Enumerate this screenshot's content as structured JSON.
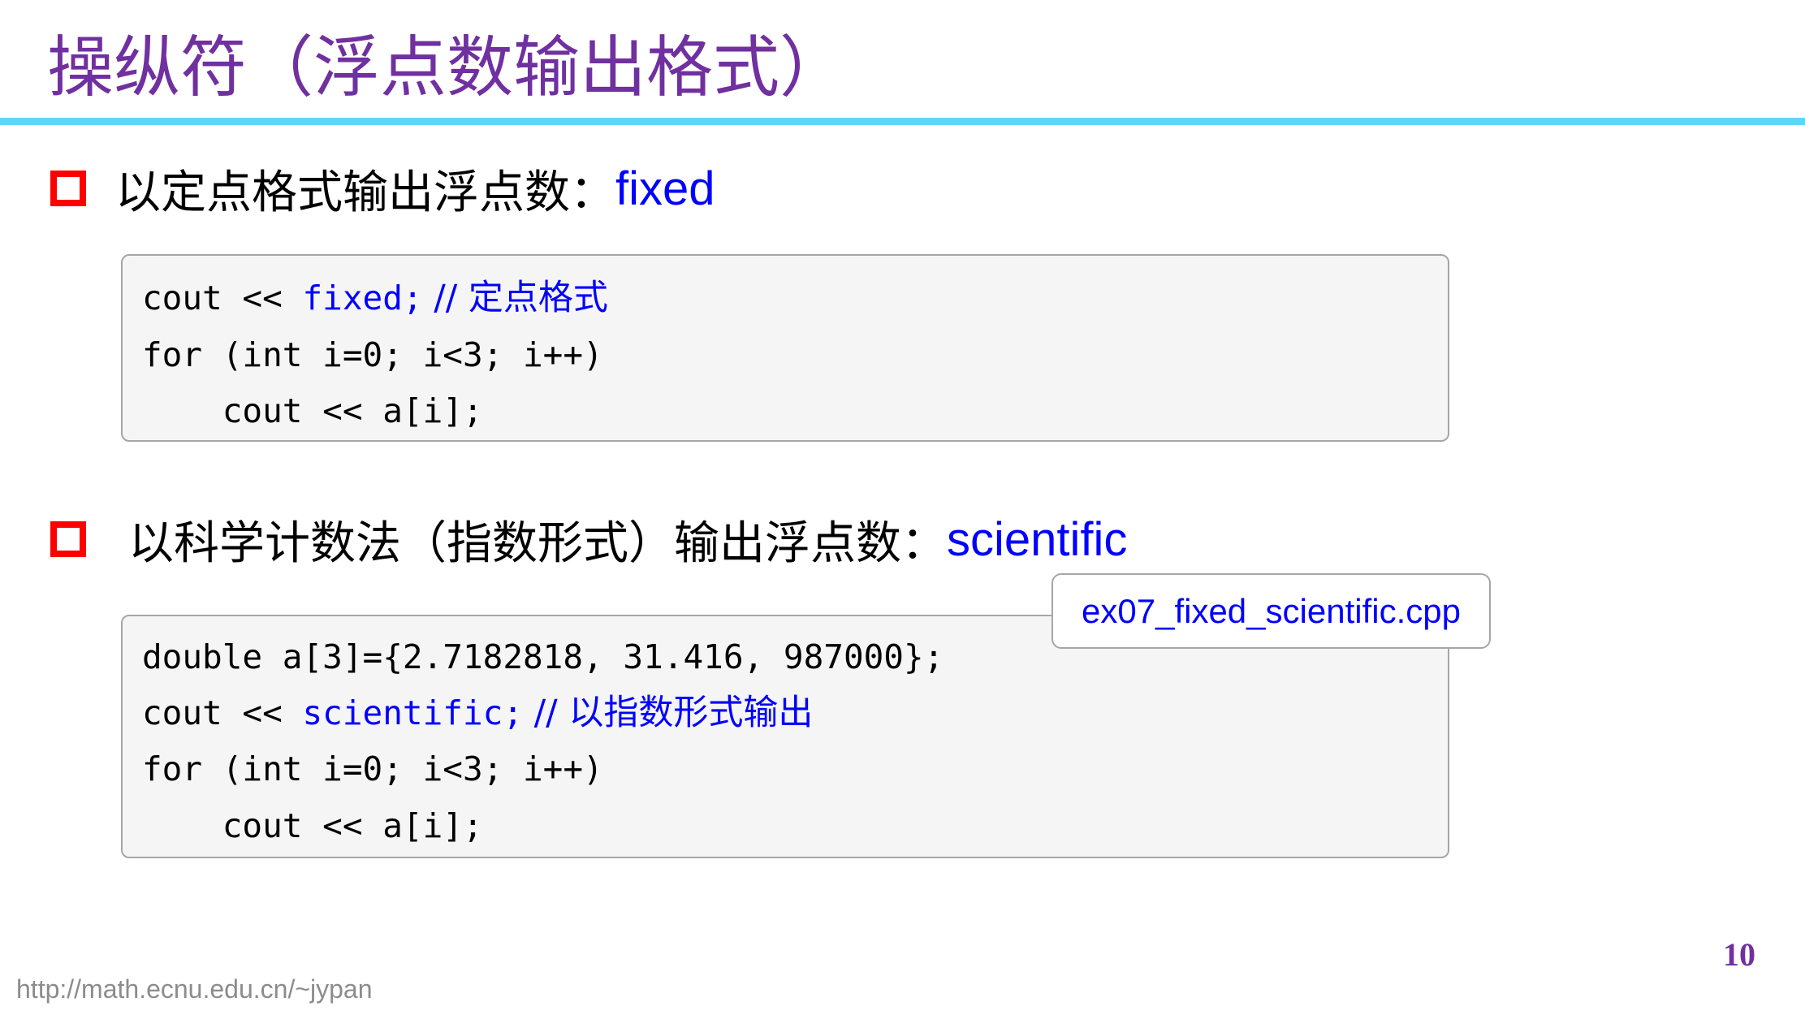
{
  "slide": {
    "title": "操纵符（浮点数输出格式）",
    "page_number": "10",
    "footer_url": "http://math.ecnu.edu.cn/~jypan"
  },
  "sections": [
    {
      "text": "以定点格式输出浮点数：",
      "keyword": "fixed",
      "code": [
        {
          "plain": "cout << ",
          "kw": "fixed;",
          "comment": " // 定点格式"
        },
        {
          "plain": "for (int i=0; i<3; i++)"
        },
        {
          "plain": "    cout << a[i];"
        }
      ]
    },
    {
      "text": "以科学计数法（指数形式）输出浮点数：",
      "keyword": "scientific",
      "code": [
        {
          "plain": "double a[3]={2.7182818, 31.416, 987000};"
        },
        {
          "plain": "cout << ",
          "kw": "scientific;",
          "comment": " // 以指数形式输出"
        },
        {
          "plain": "for (int i=0; i<3; i++)"
        },
        {
          "plain": "    cout << a[i];"
        }
      ]
    }
  ],
  "file_tag": "ex07_fixed_scientific.cpp",
  "colors": {
    "title": "#7030A0",
    "rule": "#5BD7F7",
    "bullet": "#FF0000",
    "keyword": "#0000FF"
  }
}
